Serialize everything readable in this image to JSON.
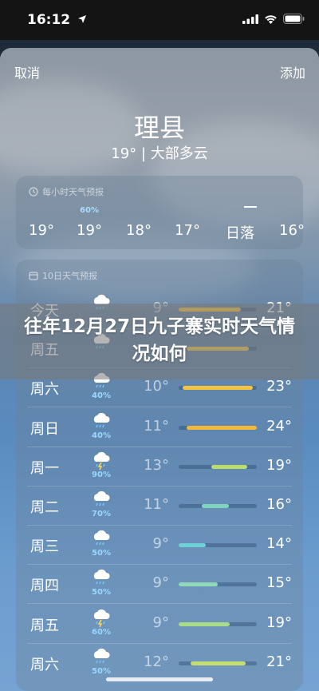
{
  "status": {
    "time": "16:12"
  },
  "nav": {
    "cancel": "取消",
    "add": "添加"
  },
  "location": {
    "city": "理县",
    "summary": "19° | 大部多云"
  },
  "hourly": {
    "header": "每小时天气预报",
    "items": [
      {
        "label": "19°",
        "pop": ""
      },
      {
        "label": "19°",
        "pop": "60%"
      },
      {
        "label": "18°",
        "pop": ""
      },
      {
        "label": "17°",
        "pop": ""
      },
      {
        "label": "日落",
        "pop": ""
      },
      {
        "label": "16°",
        "pop": ""
      }
    ]
  },
  "daily": {
    "header": "10日天气预报",
    "days": [
      {
        "day": "今天",
        "pop": "",
        "low": "9°",
        "high": "21°",
        "icon": "rain-cloud-icon",
        "bar_start": 0.0,
        "bar_end": 0.8,
        "bar_color": "#f4c340"
      },
      {
        "day": "周五",
        "pop": "",
        "low": "",
        "high": "",
        "icon": "rain-cloud-icon",
        "bar_start": 0.1,
        "bar_end": 0.9,
        "bar_color": "#f0c850"
      },
      {
        "day": "周六",
        "pop": "40%",
        "low": "10°",
        "high": "23°",
        "icon": "rain-cloud-icon",
        "bar_start": 0.05,
        "bar_end": 0.95,
        "bar_color": "#f4c340"
      },
      {
        "day": "周日",
        "pop": "40%",
        "low": "11°",
        "high": "24°",
        "icon": "rain-cloud-icon",
        "bar_start": 0.1,
        "bar_end": 1.0,
        "bar_color": "#f4b73a"
      },
      {
        "day": "周一",
        "pop": "90%",
        "low": "13°",
        "high": "19°",
        "icon": "thunderstorm-icon",
        "bar_start": 0.42,
        "bar_end": 0.88,
        "bar_color": "#b9dc6c"
      },
      {
        "day": "周二",
        "pop": "70%",
        "low": "11°",
        "high": "16°",
        "icon": "rain-cloud-icon",
        "bar_start": 0.3,
        "bar_end": 0.65,
        "bar_color": "#7fd4c0"
      },
      {
        "day": "周三",
        "pop": "50%",
        "low": "9°",
        "high": "14°",
        "icon": "rain-cloud-icon",
        "bar_start": 0.0,
        "bar_end": 0.35,
        "bar_color": "#6fd0d8"
      },
      {
        "day": "周四",
        "pop": "50%",
        "low": "9°",
        "high": "15°",
        "icon": "rain-cloud-icon",
        "bar_start": 0.0,
        "bar_end": 0.5,
        "bar_color": "#8fd8b8"
      },
      {
        "day": "周五",
        "pop": "60%",
        "low": "9°",
        "high": "19°",
        "icon": "thunderstorm-icon",
        "bar_start": 0.0,
        "bar_end": 0.65,
        "bar_color": "#a8dc88"
      },
      {
        "day": "周六",
        "pop": "50%",
        "low": "12°",
        "high": "21°",
        "icon": "rain-cloud-icon",
        "bar_start": 0.15,
        "bar_end": 0.85,
        "bar_color": "#c6de70"
      }
    ]
  },
  "banner": {
    "title": "往年12月27日九子寨实时天气情况如何"
  }
}
